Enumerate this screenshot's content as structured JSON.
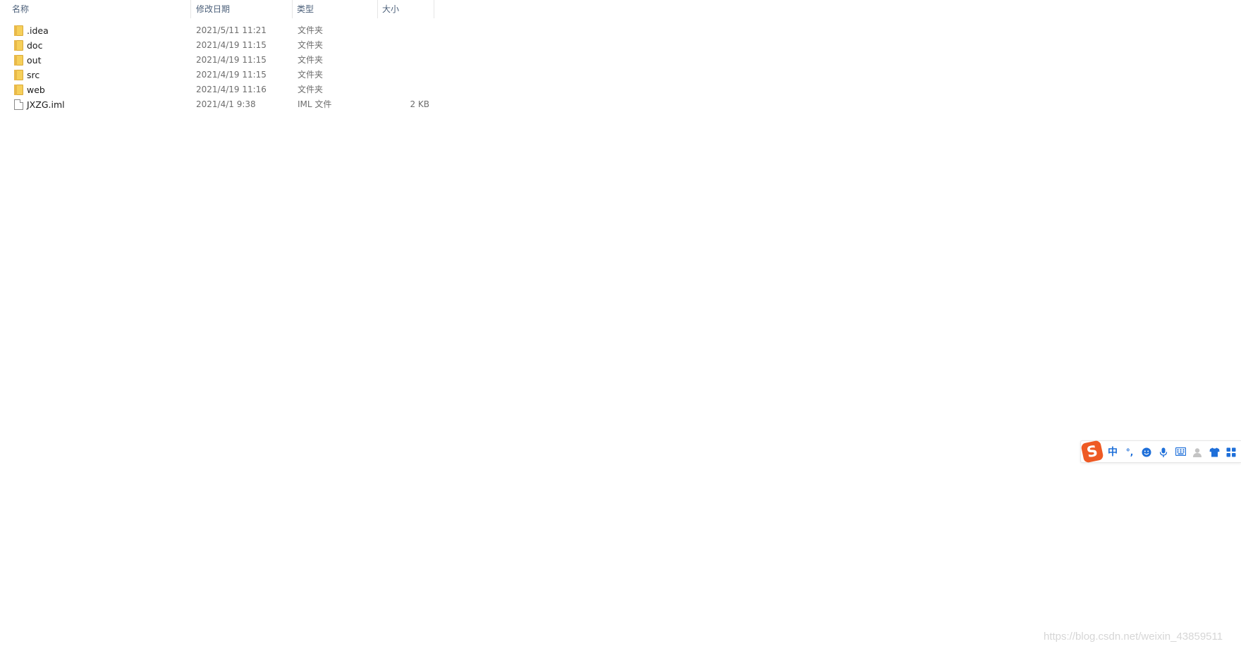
{
  "columns": {
    "name": "名称",
    "modified": "修改日期",
    "type": "类型",
    "size": "大小"
  },
  "sort": {
    "column": "name",
    "direction": "ascending",
    "indicator": "^"
  },
  "files": [
    {
      "name": ".idea",
      "modified": "2021/5/11 11:21",
      "type": "文件夹",
      "size": "",
      "icon": "folder-icon"
    },
    {
      "name": "doc",
      "modified": "2021/4/19 11:15",
      "type": "文件夹",
      "size": "",
      "icon": "folder-icon"
    },
    {
      "name": "out",
      "modified": "2021/4/19 11:15",
      "type": "文件夹",
      "size": "",
      "icon": "folder-icon"
    },
    {
      "name": "src",
      "modified": "2021/4/19 11:15",
      "type": "文件夹",
      "size": "",
      "icon": "folder-icon"
    },
    {
      "name": "web",
      "modified": "2021/4/19 11:16",
      "type": "文件夹",
      "size": "",
      "icon": "folder-icon"
    },
    {
      "name": "JXZG.iml",
      "modified": "2021/4/1 9:38",
      "type": "IML 文件",
      "size": "2 KB",
      "icon": "file-icon"
    }
  ],
  "ime": {
    "logo": "S",
    "mode": "中",
    "punctuation": "°,",
    "buttons": [
      "emoji-icon",
      "microphone-icon",
      "keyboard-icon",
      "user-icon",
      "skin-icon",
      "apps-icon"
    ]
  },
  "watermark": "https://blog.csdn.net/weixin_43859511",
  "colors": {
    "header_text": "#4c607a",
    "folder": "#f6cf5a",
    "ime_accent": "#1e6fd9",
    "ime_logo": "#ee5a24"
  }
}
